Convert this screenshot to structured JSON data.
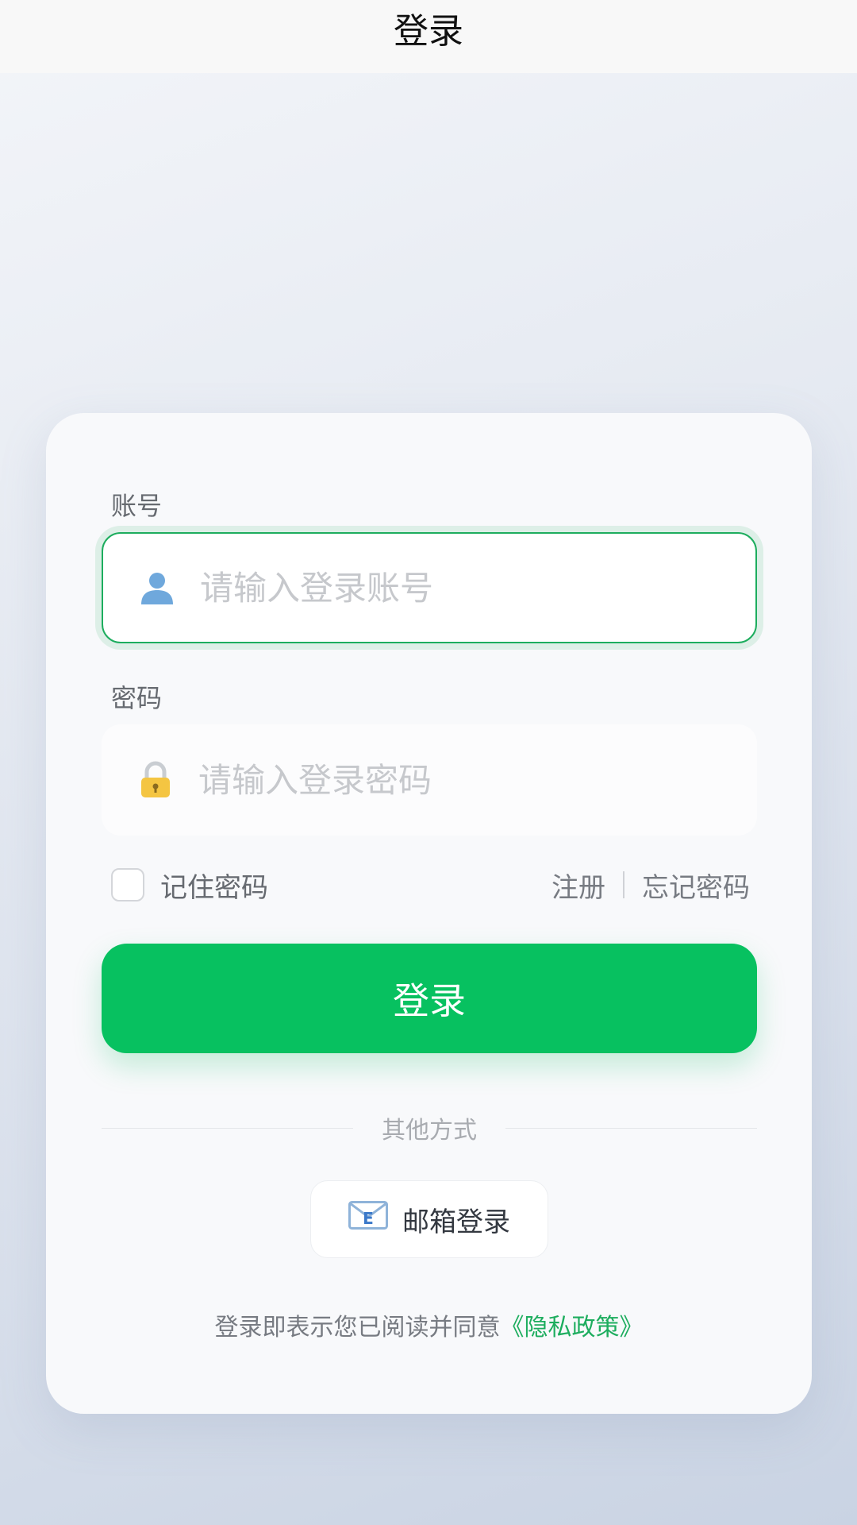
{
  "navbar": {
    "title": "登录"
  },
  "account": {
    "label": "账号",
    "icon": "user-icon",
    "placeholder": "请输入登录账号"
  },
  "password": {
    "label": "密码",
    "icon": "lock-icon",
    "placeholder": "请输入登录密码"
  },
  "options": {
    "remember_label": "记住密码",
    "register_label": "注册",
    "forgot_label": "忘记密码"
  },
  "login_button": {
    "label": "登录"
  },
  "divider": {
    "label": "其他方式"
  },
  "email_login": {
    "icon": "email-icon",
    "label": "邮箱登录"
  },
  "privacy": {
    "prefix": "登录即表示您已阅读并同意",
    "link": "《隐私政策》"
  },
  "colors": {
    "accent": "#07c160",
    "link": "#1dad5e"
  }
}
